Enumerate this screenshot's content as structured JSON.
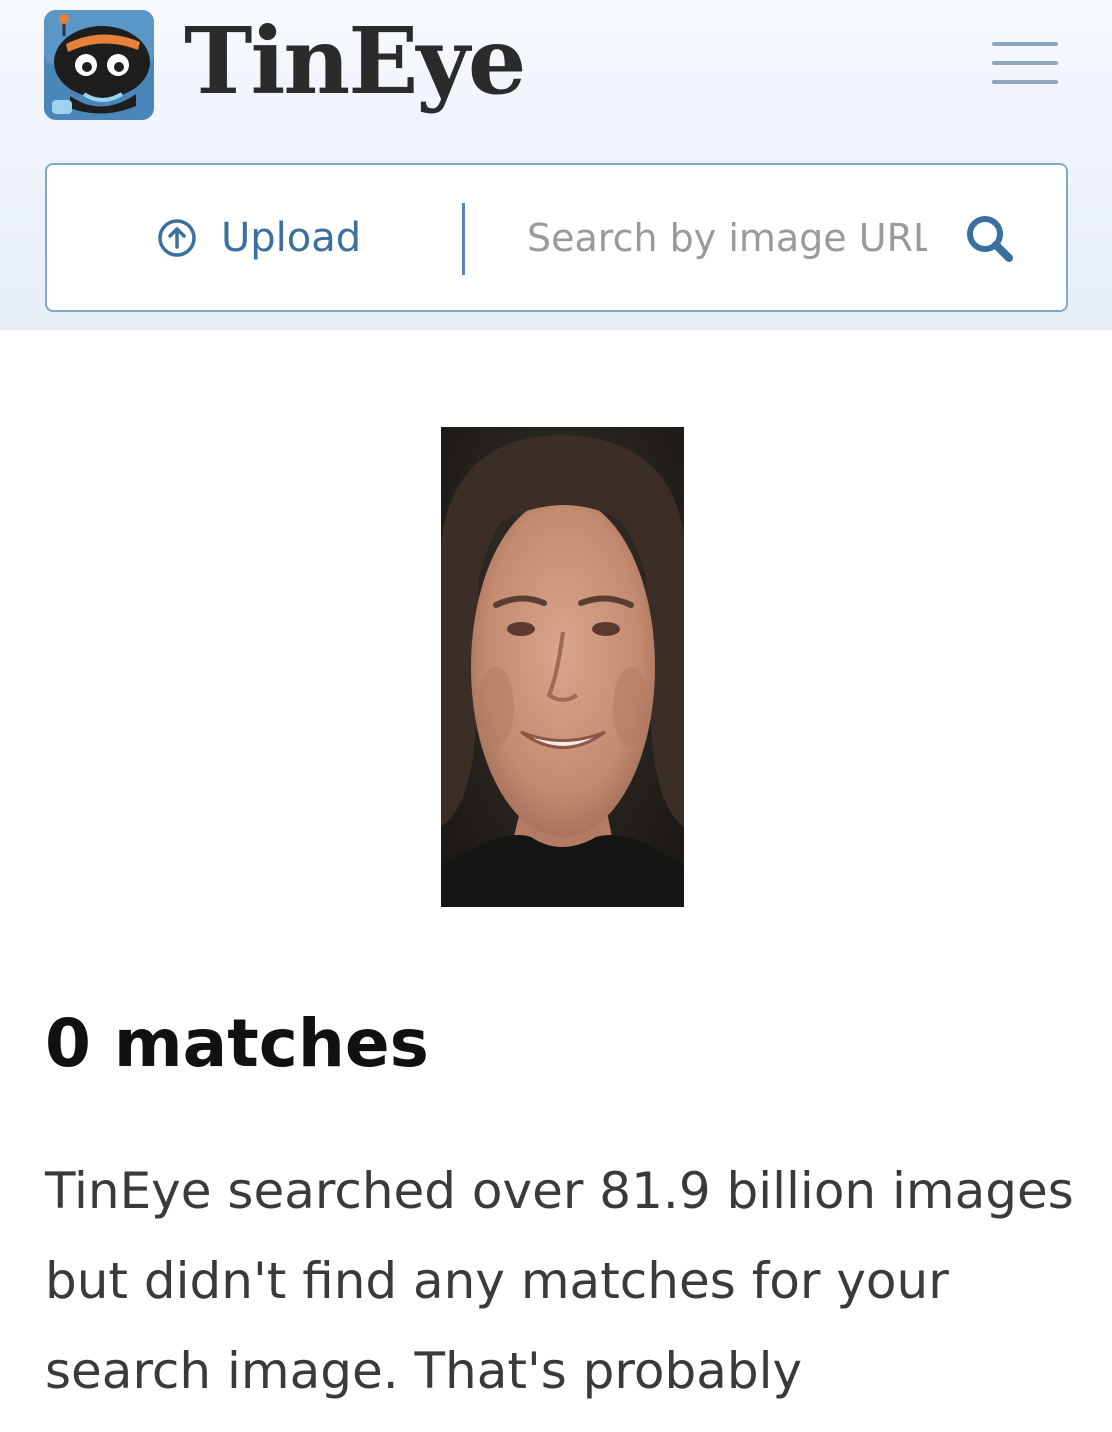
{
  "header": {
    "logo_text": "TinEye",
    "menu_icon": "hamburger-menu-icon"
  },
  "search": {
    "upload_label": "Upload",
    "upload_icon": "upload-arrow-icon",
    "url_placeholder": "Search by image URL",
    "url_value": "",
    "search_icon": "magnifier-icon"
  },
  "query_image": {
    "description_icon": "uploaded-query-photo"
  },
  "results": {
    "matches_heading": "0 matches",
    "message": "TinEye searched over 81.9 billion images but didn't find any matches for your search image. That's probably"
  },
  "colors": {
    "brand_blue": "#3a6fa0",
    "header_background": "#eef3fa",
    "search_border": "#7fa9c5"
  }
}
